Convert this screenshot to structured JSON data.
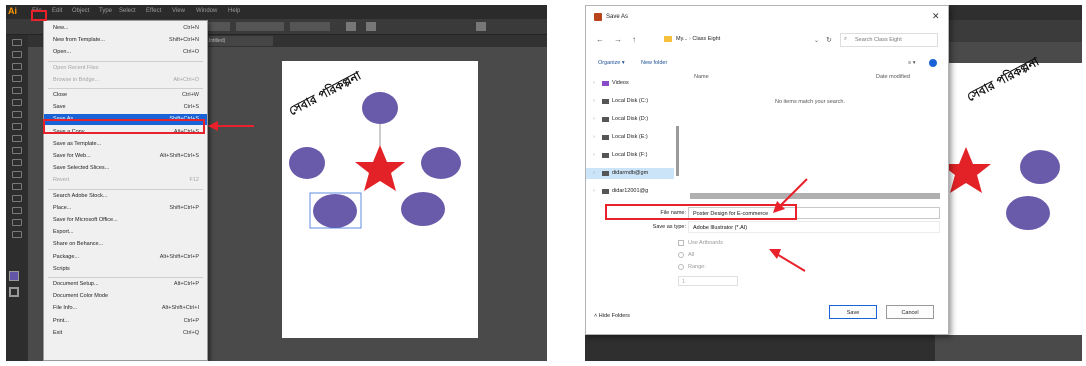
{
  "illustrator": {
    "menubar": [
      "File",
      "Edit",
      "Object",
      "Type",
      "Select",
      "Effect",
      "View",
      "Window",
      "Help"
    ],
    "app_logo": "Ai",
    "doc_tab": "(Untitled)",
    "file_menu": [
      {
        "label": "New...",
        "shortcut": "Ctrl+N",
        "disabled": false
      },
      {
        "label": "New from Template...",
        "shortcut": "Shift+Ctrl+N",
        "disabled": false
      },
      {
        "label": "Open...",
        "shortcut": "Ctrl+O",
        "disabled": false
      },
      {
        "label": "Open Recent Files",
        "shortcut": "",
        "disabled": true
      },
      {
        "label": "Browse in Bridge...",
        "shortcut": "Alt+Ctrl+O",
        "disabled": true
      },
      {
        "label": "Close",
        "shortcut": "Ctrl+W",
        "disabled": false
      },
      {
        "label": "Save",
        "shortcut": "Ctrl+S",
        "disabled": false
      },
      {
        "label": "Save As...",
        "shortcut": "Shift+Ctrl+S",
        "disabled": false,
        "selected": true
      },
      {
        "label": "Save a Copy...",
        "shortcut": "Alt+Ctrl+S",
        "disabled": false
      },
      {
        "label": "Save as Template...",
        "shortcut": "",
        "disabled": false
      },
      {
        "label": "Save for Web...",
        "shortcut": "Alt+Shift+Ctrl+S",
        "disabled": false
      },
      {
        "label": "Save Selected Slices...",
        "shortcut": "",
        "disabled": false
      },
      {
        "label": "Revert",
        "shortcut": "F12",
        "disabled": true
      },
      {
        "label": "Search Adobe Stock...",
        "shortcut": "",
        "disabled": false
      },
      {
        "label": "Place...",
        "shortcut": "Shift+Ctrl+P",
        "disabled": false
      },
      {
        "label": "Save for Microsoft Office...",
        "shortcut": "",
        "disabled": false
      },
      {
        "label": "Export...",
        "shortcut": "",
        "disabled": false
      },
      {
        "label": "Share on Behance...",
        "shortcut": "",
        "disabled": false
      },
      {
        "label": "Package...",
        "shortcut": "Alt+Shift+Ctrl+P",
        "disabled": false
      },
      {
        "label": "Scripts",
        "shortcut": "",
        "disabled": false
      },
      {
        "label": "Document Setup...",
        "shortcut": "Alt+Ctrl+P",
        "disabled": false
      },
      {
        "label": "Document Color Mode",
        "shortcut": "",
        "disabled": false
      },
      {
        "label": "File Info...",
        "shortcut": "Alt+Shift+Ctrl+I",
        "disabled": false
      },
      {
        "label": "Print...",
        "shortcut": "Ctrl+P",
        "disabled": false
      },
      {
        "label": "Exit",
        "shortcut": "Ctrl+Q",
        "disabled": false
      }
    ],
    "artboard_title": "সেবার পরিকল্পনা",
    "shape_colors": {
      "ellipse": "#6a5aaa",
      "star": "#e32227",
      "line": "#999999"
    }
  },
  "save_dialog": {
    "title": "Save As",
    "close_glyph": "✕",
    "breadcrumb": [
      "My...",
      "Class Eight"
    ],
    "search_placeholder": "Search Class Eight",
    "organize_label": "Organize ▾",
    "new_folder_label": "New folder",
    "nav_items": [
      "Videos",
      "Local Disk (C:)",
      "Local Disk (D:)",
      "Local Disk (E:)",
      "Local Disk (F:)",
      "didarmdb@gm",
      "didar12001@g"
    ],
    "col_name": "Name",
    "col_date": "Date modified",
    "empty_message": "No items match your search.",
    "file_name_label": "File name:",
    "file_name_value": "Poster Design for E-commerce",
    "save_type_label": "Save as type:",
    "save_type_value": "Adobe Illustrator (*.AI)",
    "use_artboards_label": "Use Artboards",
    "all_label": "All",
    "range_label": "Range:",
    "range_value": "1",
    "hide_folders_label": "Hide Folders",
    "save_label": "Save",
    "cancel_label": "Cancel"
  },
  "accent_colors": {
    "highlight_red": "#e8212a",
    "menu_selection": "#1a63d6"
  }
}
